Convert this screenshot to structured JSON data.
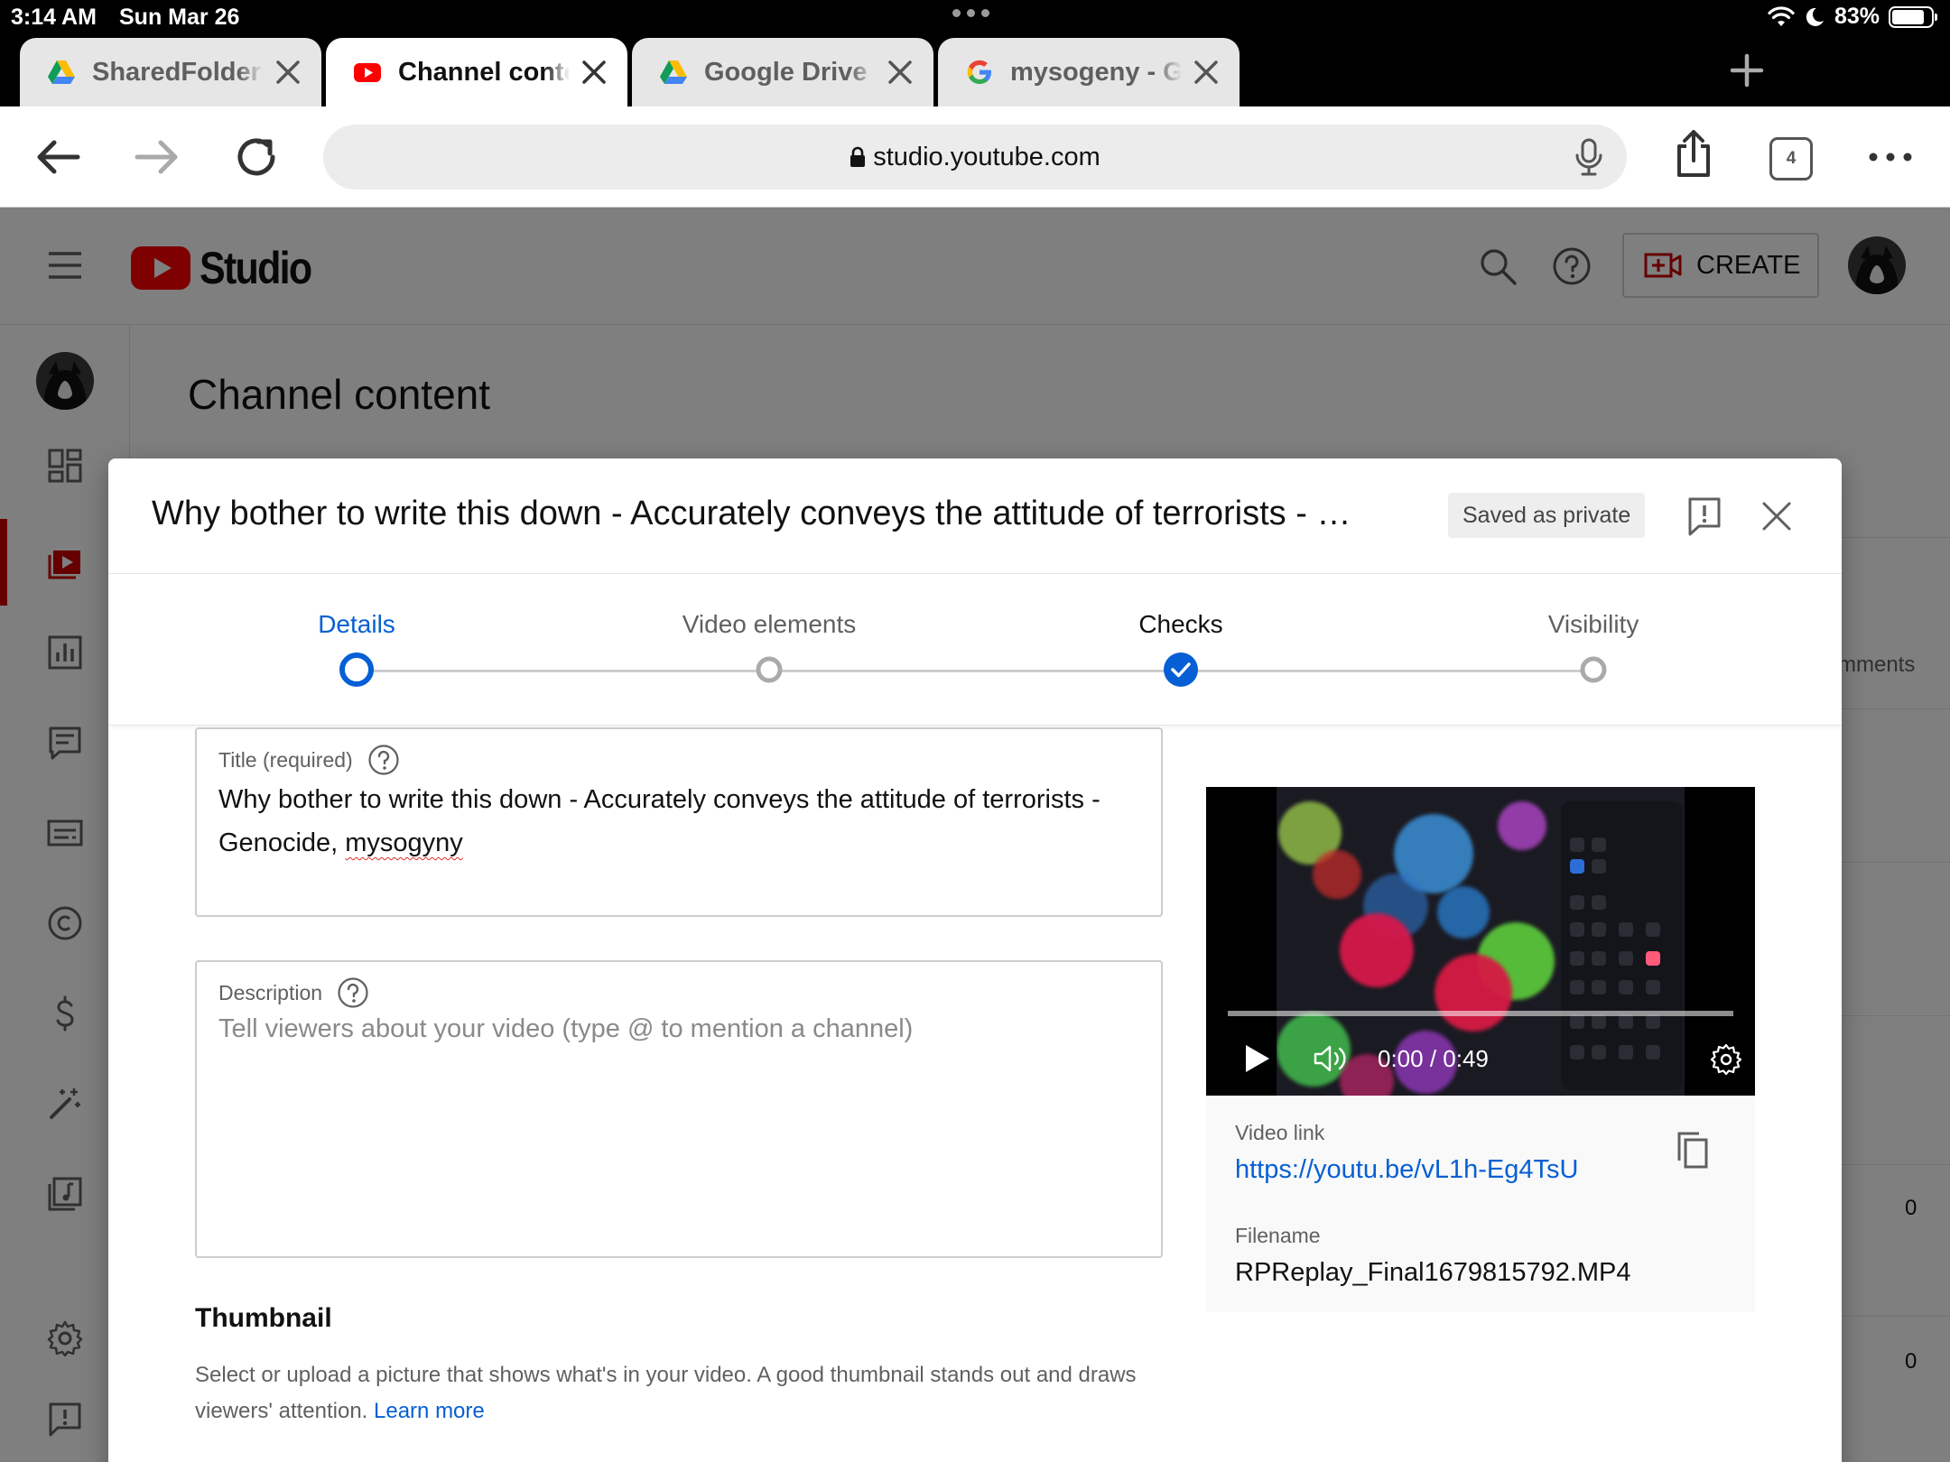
{
  "status_bar": {
    "time": "3:14 AM",
    "date": "Sun Mar 26",
    "battery": "83%",
    "battery_level": 0.83
  },
  "tabs": [
    {
      "title": "SharedFoldersGroup - Google Drive",
      "icon": "google-drive-icon",
      "active": false
    },
    {
      "title": "Channel content - YouTube Studio",
      "icon": "youtube-icon",
      "active": true
    },
    {
      "title": "Google Drive",
      "icon": "google-drive-icon",
      "active": false
    },
    {
      "title": "mysogeny - Google Search",
      "icon": "google-icon",
      "active": false
    }
  ],
  "address_bar": {
    "url": "studio.youtube.com",
    "tab_count": "4"
  },
  "studio": {
    "logo_text": "Studio",
    "create_label": "CREATE",
    "page_title": "Channel content",
    "background_column_header": "mments",
    "background_values": [
      "0",
      "0"
    ]
  },
  "modal": {
    "title": "Why bother to write this down - Accurately conveys the attitude of terrorists - Genocide, mysogyny",
    "saved_status": "Saved as private",
    "steps": [
      {
        "label": "Details",
        "state": "current"
      },
      {
        "label": "Video elements",
        "state": "pending"
      },
      {
        "label": "Checks",
        "state": "done"
      },
      {
        "label": "Visibility",
        "state": "pending"
      }
    ],
    "title_field": {
      "label": "Title (required)",
      "value_main": "Why bother to write this down -  Accurately conveys the attitude of terrorists - Genocide, ",
      "value_misspelled": "mysogyny"
    },
    "description_field": {
      "label": "Description",
      "placeholder": "Tell viewers about your video (type @ to mention a channel)"
    },
    "thumbnail": {
      "title": "Thumbnail",
      "description": "Select or upload a picture that shows what's in your video. A good thumbnail stands out and draws viewers' attention.",
      "learn_more": "Learn more"
    },
    "player": {
      "time": "0:00 / 0:49"
    },
    "video_link_label": "Video link",
    "video_link": "https://youtu.be/vL1h-Eg4TsU",
    "filename_label": "Filename",
    "filename": "RPReplay_Final1679815792.MP4"
  }
}
